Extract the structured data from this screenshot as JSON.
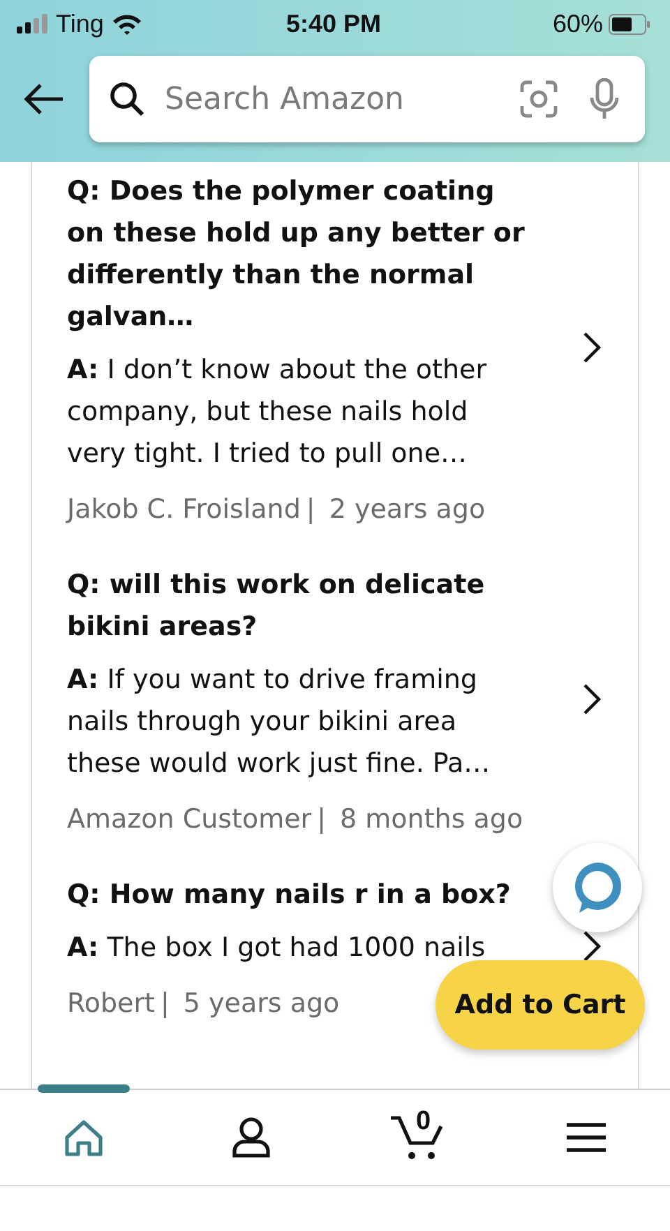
{
  "status_bar": {
    "carrier": "Ting",
    "time": "5:40 PM",
    "battery": "60%"
  },
  "search": {
    "placeholder": "Search Amazon"
  },
  "questions": [
    {
      "question": "Q: Does the polymer coating on these hold up any better or differently than the normal galvan…",
      "answer": "**A:** I don’t know about the other company, but these nails hold very tight. I tried to pull one…",
      "author": "Jakob C. Froisland",
      "separator": "|",
      "time": "2 years ago"
    },
    {
      "question": "Q: will this work on delicate bikini areas?",
      "answer": "**A:** If you want to drive framing nails through your bikini area these would work just fine. Pa…",
      "author": "Amazon Customer",
      "separator": "|",
      "time": "8 months ago"
    },
    {
      "question": "Q: How many nails r in a box?",
      "answer": "**A:** The box I got had 1000 nails",
      "author": "Robert",
      "separator": "|",
      "time": "5 years ago"
    }
  ],
  "add_to_cart": "Add to Cart",
  "nav": [
    {
      "kind": "home",
      "selected": true
    },
    {
      "kind": "account",
      "selected": false
    },
    {
      "kind": "cart",
      "selected": false,
      "count": "0"
    },
    {
      "kind": "menu",
      "selected": false
    }
  ]
}
